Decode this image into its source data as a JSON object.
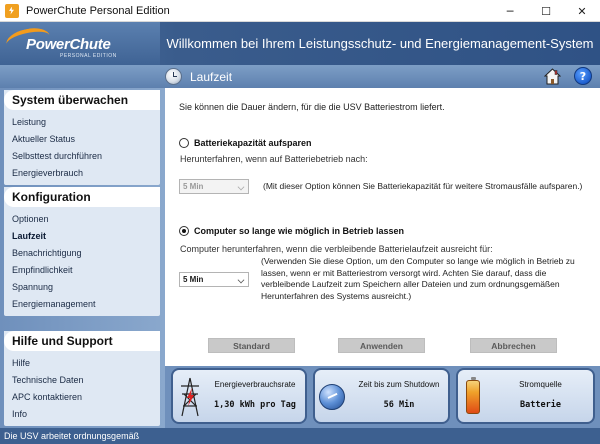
{
  "window": {
    "title": "PowerChute Personal Edition",
    "minimize": "─",
    "maximize": "☐",
    "close": "✕"
  },
  "header": {
    "logo_text": "PowerChute",
    "logo_sub": "PERSONAL EDITION",
    "title": "Willkommen bei Ihrem Leistungsschutz- und Energiemanagement-System"
  },
  "subheader": {
    "page_title": "Laufzeit",
    "home_icon": "home-icon",
    "help_label": "?"
  },
  "sidebar": {
    "sections": [
      {
        "title": "System überwachen",
        "items": [
          "Leistung",
          "Aktueller Status",
          "Selbsttest durchführen",
          "Energieverbrauch"
        ]
      },
      {
        "title": "Konfiguration",
        "items": [
          "Optionen",
          "Laufzeit",
          "Benachrichtigung",
          "Empfindlichkeit",
          "Spannung",
          "Energiemanagement"
        ],
        "active": "Laufzeit"
      },
      {
        "title": "Hilfe und Support",
        "items": [
          "Hilfe",
          "Technische Daten",
          "APC kontaktieren",
          "Info"
        ]
      }
    ]
  },
  "main": {
    "intro": "Sie können die Dauer ändern, für die die USV Batteriestrom liefert.",
    "option1": {
      "label": "Batteriekapazität aufsparen",
      "desc": "Herunterfahren, wenn auf Batteriebetrieb nach:",
      "select_value": "5 Min",
      "note": "(Mit dieser Option können Sie Batteriekapazität für weitere Stromausfälle aufsparen.)",
      "checked": false
    },
    "option2": {
      "label": "Computer so lange wie möglich in Betrieb lassen",
      "desc": "Computer herunterfahren, wenn die verbleibende Batterielaufzeit ausreicht für:",
      "select_value": "5 Min",
      "note": "(Verwenden Sie diese Option, um den Computer so lange wie möglich in Betrieb zu lassen, wenn er mit Batteriestrom versorgt wird. Achten Sie darauf, dass die verbleibende Laufzeit zum Speichern aller Dateien und zum ordnungsgemäßen Herunterfahren des Systems ausreicht.)",
      "checked": true
    },
    "buttons": {
      "standard": "Standard",
      "apply": "Anwenden",
      "cancel": "Abbrechen"
    }
  },
  "panels": {
    "energy": {
      "title": "Energieverbrauchsrate",
      "value": "1,30 kWh pro Tag"
    },
    "shutdown": {
      "title": "Zeit bis zum Shutdown",
      "value": "56 Min"
    },
    "source": {
      "title": "Stromquelle",
      "value": "Batterie"
    }
  },
  "status": {
    "text": "Die USV arbeitet ordnungsgemäß"
  },
  "colors": {
    "header_blue": "#3a5c8c",
    "logo_orange": "#f39b1c",
    "sidebar_blue": "#7d9ec6",
    "status_blue": "#3d6090"
  }
}
